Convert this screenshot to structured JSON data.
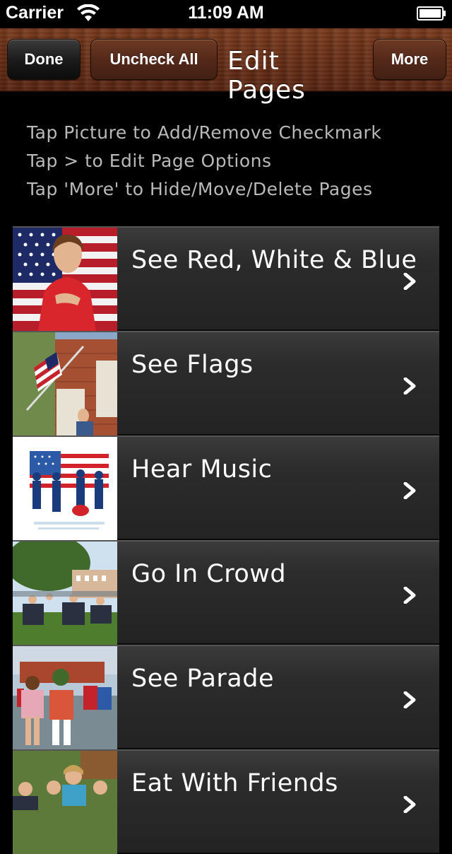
{
  "status_bar": {
    "carrier": "Carrier",
    "time": "11:09 AM"
  },
  "nav": {
    "done_label": "Done",
    "uncheck_all_label": "Uncheck All",
    "title": "Edit Pages",
    "more_label": "More"
  },
  "instructions": [
    "Tap Picture to Add/Remove Checkmark",
    "Tap > to Edit Page Options",
    "Tap 'More' to Hide/Move/Delete Pages"
  ],
  "pages": [
    {
      "title": "See Red, White & Blue",
      "thumb": "boy-with-flag"
    },
    {
      "title": "See Flags",
      "thumb": "flag-on-house"
    },
    {
      "title": "Hear Music",
      "thumb": "band-silhouette"
    },
    {
      "title": "Go In Crowd",
      "thumb": "crowd-lawn"
    },
    {
      "title": "See Parade",
      "thumb": "parade-kids"
    },
    {
      "title": "Eat With Friends",
      "thumb": "friends-picnic"
    }
  ],
  "colors": {
    "background": "#000000",
    "instruction_text": "#b9b9b9",
    "row_bg": "#2c2c2c",
    "wood": "#6b2f15"
  }
}
